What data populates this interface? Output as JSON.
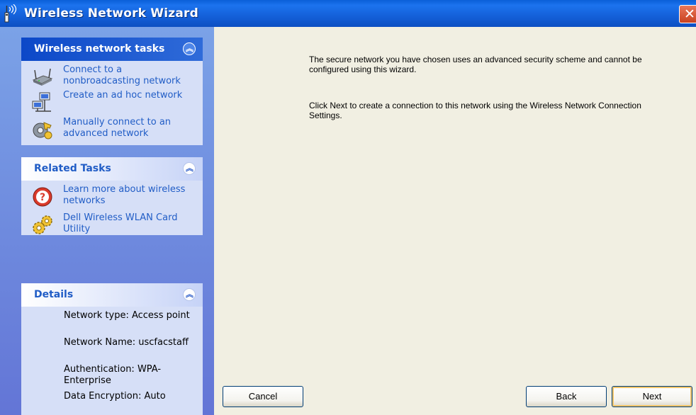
{
  "window": {
    "title": "Wireless Network Wizard",
    "close_glyph": "✕"
  },
  "sidebar": {
    "wireless_tasks": {
      "title": "Wireless network tasks",
      "items": [
        {
          "label": "Connect to a nonbroadcasting network",
          "icon": "router-icon"
        },
        {
          "label": "Create an ad hoc network",
          "icon": "computers-network-icon"
        },
        {
          "label": "Manually connect to an advanced network",
          "icon": "gear-key-icon"
        }
      ]
    },
    "related_tasks": {
      "title": "Related Tasks",
      "items": [
        {
          "label": "Learn more about wireless networks",
          "icon": "help-icon"
        },
        {
          "label": "Dell Wireless WLAN Card Utility",
          "icon": "gears-icon"
        }
      ]
    },
    "details": {
      "title": "Details",
      "lines": [
        "Network type: Access point",
        "Network Name: uscfacstaff",
        "Authentication: WPA-Enterprise",
        "Data Encryption: Auto"
      ]
    }
  },
  "main": {
    "message1": "The secure network you have chosen uses an advanced security scheme and cannot be configured using this wizard.",
    "message2": "Click Next to create a connection to this network using the Wireless Network Connection Settings."
  },
  "buttons": {
    "cancel": "Cancel",
    "back": "Back",
    "next": "Next"
  },
  "colors": {
    "titlebar": "#1460d9",
    "sidebar": "#7ba2e7",
    "link": "#215dc6",
    "main_bg": "#f1efe2"
  }
}
